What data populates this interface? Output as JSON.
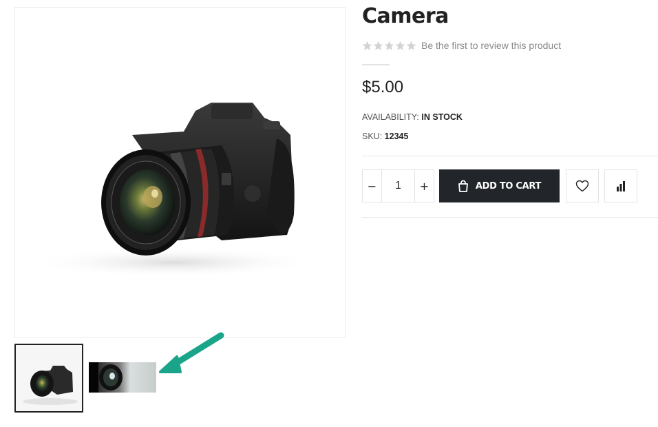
{
  "product": {
    "title": "Camera",
    "rating": {
      "stars": 0,
      "max": 5,
      "review_text": "Be the first to review this product"
    },
    "price": "$5.00",
    "availability": {
      "label": "AVAILABILITY:",
      "value": "IN STOCK"
    },
    "sku": {
      "label": "SKU:",
      "value": "12345"
    }
  },
  "cart": {
    "quantity": "1",
    "minus_label": "−",
    "plus_label": "+",
    "add_to_cart_label": "ADD TO CART"
  },
  "gallery": {
    "main_image": "dslr-camera-photo",
    "thumbnails": [
      "dslr-camera-thumbnail",
      "camera-lens-thumbnail"
    ],
    "annotation": "teal-arrow"
  },
  "colors": {
    "button_dark": "#222529",
    "star_empty": "#d3d3d3",
    "annotation_arrow": "#1aa58a"
  }
}
